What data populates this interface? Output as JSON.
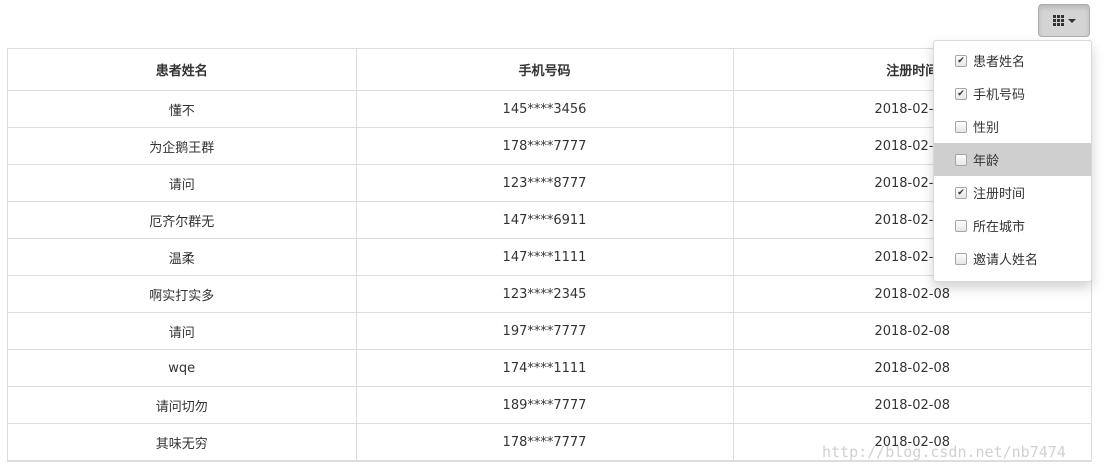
{
  "toolbar": {
    "columns_button_icon": "grid-icon"
  },
  "table": {
    "headers": [
      "患者姓名",
      "手机号码",
      "注册时间"
    ],
    "rows": [
      {
        "name": "懂不",
        "phone": "145****3456",
        "date": "2018-02-08"
      },
      {
        "name": "为企鹅王群",
        "phone": "178****7777",
        "date": "2018-02-08"
      },
      {
        "name": "请问",
        "phone": "123****8777",
        "date": "2018-02-08"
      },
      {
        "name": "厄齐尔群无",
        "phone": "147****6911",
        "date": "2018-02-08"
      },
      {
        "name": "温柔",
        "phone": "147****1111",
        "date": "2018-02-08"
      },
      {
        "name": "啊实打实多",
        "phone": "123****2345",
        "date": "2018-02-08"
      },
      {
        "name": "请问",
        "phone": "197****7777",
        "date": "2018-02-08"
      },
      {
        "name": "wqe",
        "phone": "174****1111",
        "date": "2018-02-08"
      },
      {
        "name": "请问切勿",
        "phone": "189****7777",
        "date": "2018-02-08"
      },
      {
        "name": "其味无穷",
        "phone": "178****7777",
        "date": "2018-02-08"
      }
    ]
  },
  "column_menu": {
    "items": [
      {
        "label": "患者姓名",
        "checked": true
      },
      {
        "label": "手机号码",
        "checked": true
      },
      {
        "label": "性别",
        "checked": false
      },
      {
        "label": "年龄",
        "checked": false
      },
      {
        "label": "注册时间",
        "checked": true
      },
      {
        "label": "所在城市",
        "checked": false
      },
      {
        "label": "邀请人姓名",
        "checked": false
      }
    ],
    "hovered_index": 3
  },
  "watermark": "http://blog.csdn.net/nb7474"
}
